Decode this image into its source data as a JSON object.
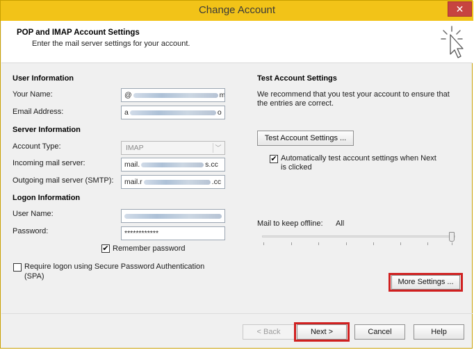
{
  "window": {
    "title": "Change Account",
    "close_glyph": "✕"
  },
  "header": {
    "title": "POP and IMAP Account Settings",
    "subtitle": "Enter the mail server settings for your account."
  },
  "user_info": {
    "heading": "User Information",
    "your_name_label": "Your Name:",
    "your_name_prefix": "@",
    "your_name_suffix": "m",
    "email_label": "Email Address:",
    "email_prefix": "a",
    "email_suffix": "o"
  },
  "server_info": {
    "heading": "Server Information",
    "account_type_label": "Account Type:",
    "account_type_value": "IMAP",
    "incoming_label": "Incoming mail server:",
    "incoming_prefix": "mail.",
    "incoming_suffix": "s.cc",
    "outgoing_label": "Outgoing mail server (SMTP):",
    "outgoing_prefix": "mail.r",
    "outgoing_suffix": ".cc"
  },
  "logon_info": {
    "heading": "Logon Information",
    "username_label": "User Name:",
    "password_label": "Password:",
    "password_value": "************",
    "remember_label": "Remember password",
    "remember_checked": true,
    "spa_label_line1": "Require logon using Secure Password Authentication",
    "spa_label_line2": "(SPA)",
    "spa_checked": false
  },
  "test_settings": {
    "heading": "Test Account Settings",
    "desc_line1": "We recommend that you test your account to ensure that",
    "desc_line2": "the entries are correct.",
    "button_label": "Test Account Settings ...",
    "auto_test_line1": "Automatically test account settings when Next",
    "auto_test_line2": "is clicked",
    "auto_test_checked": true
  },
  "offline": {
    "label": "Mail to keep offline:",
    "value": "All",
    "slider_fraction": 1.0
  },
  "buttons": {
    "more_settings": "More Settings ...",
    "back": "< Back",
    "next": "Next >",
    "cancel": "Cancel",
    "help": "Help"
  },
  "icons": {
    "header_icon": "cursor-click-icon",
    "check_glyph": "✔",
    "dropdown_glyph": "﹀"
  },
  "colors": {
    "titlebar": "#f2c318",
    "close": "#c74440",
    "highlight": "#d02020"
  }
}
